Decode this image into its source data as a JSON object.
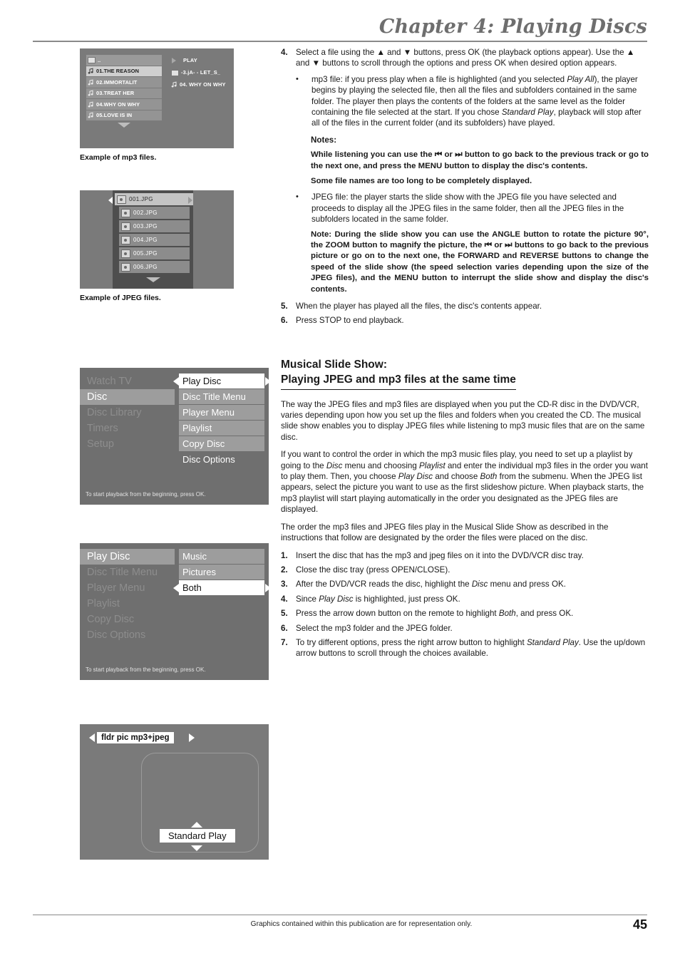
{
  "header": {
    "chapter_title": "Chapter 4: Playing Discs"
  },
  "footer": {
    "note": "Graphics contained within this publication are for representation only.",
    "page_number": "45"
  },
  "osd_mp3": {
    "caption": "Example of mp3 files.",
    "left_rows": [
      {
        "icon": "folder-icon",
        "label": "..",
        "state": "parent"
      },
      {
        "icon": "music-note-icon",
        "label": "01.THE REASON",
        "state": "selected"
      },
      {
        "icon": "music-note-icon",
        "label": "02.IMMORTALIT",
        "state": "normal"
      },
      {
        "icon": "music-note-icon",
        "label": "03.TREAT HER",
        "state": "normal"
      },
      {
        "icon": "music-note-icon",
        "label": "04.WHY ON WHY",
        "state": "normal"
      },
      {
        "icon": "music-note-icon",
        "label": "05.LOVE IS IN",
        "state": "normal"
      }
    ],
    "right_rows": [
      {
        "icon": "play-triangle-icon",
        "label": "PLAY"
      },
      {
        "icon": "folder-icon",
        "label": "-3.jA- - LET_S_"
      },
      {
        "icon": "music-note-icon",
        "label": "04. WHY ON WHY"
      }
    ]
  },
  "osd_jpeg": {
    "caption": "Example of JPEG files.",
    "rows": [
      {
        "icon": "photo-icon",
        "label": "001.JPG",
        "state": "selected"
      },
      {
        "icon": "photo-icon",
        "label": "002.JPG",
        "state": "normal"
      },
      {
        "icon": "photo-icon",
        "label": "003.JPG",
        "state": "normal"
      },
      {
        "icon": "photo-icon",
        "label": "004.JPG",
        "state": "normal"
      },
      {
        "icon": "photo-icon",
        "label": "005.JPG",
        "state": "normal"
      },
      {
        "icon": "photo-icon",
        "label": "006.JPG",
        "state": "normal"
      }
    ]
  },
  "osd_disc_menu": {
    "left_items": [
      {
        "label": "Watch TV",
        "state": "dim"
      },
      {
        "label": "Disc",
        "state": "active"
      },
      {
        "label": "Disc Library",
        "state": "dim"
      },
      {
        "label": "Timers",
        "state": "dim"
      },
      {
        "label": "Setup",
        "state": "dim"
      }
    ],
    "right_items": [
      {
        "label": "Play Disc",
        "state": "selected"
      },
      {
        "label": "Disc Title Menu",
        "state": "normal"
      },
      {
        "label": "Player Menu",
        "state": "normal"
      },
      {
        "label": "Playlist",
        "state": "normal"
      },
      {
        "label": "Copy Disc",
        "state": "normal"
      },
      {
        "label": "Disc Options",
        "state": "plain"
      }
    ],
    "hint": "To start playback from the beginning, press OK."
  },
  "osd_play_disc": {
    "left_items": [
      {
        "label": "Play Disc",
        "state": "active"
      },
      {
        "label": "Disc Title Menu",
        "state": "dim"
      },
      {
        "label": "Player Menu",
        "state": "dim"
      },
      {
        "label": "Playlist",
        "state": "dim"
      },
      {
        "label": "Copy Disc",
        "state": "dim"
      },
      {
        "label": "Disc Options",
        "state": "dim"
      }
    ],
    "right_items": [
      {
        "label": "Music",
        "state": "normal"
      },
      {
        "label": "Pictures",
        "state": "normal"
      },
      {
        "label": "Both",
        "state": "selected"
      }
    ],
    "hint": "To start playback from the beginning, press OK."
  },
  "osd_slideshow": {
    "folder_label": "fldr pic mp3+jpeg",
    "play_mode_label": "Standard Play"
  },
  "steps": {
    "step4_num": "4.",
    "step4_text_a": "Select a file using the ",
    "step4_up": "▲",
    "step4_and": " and ",
    "step4_down": "▼",
    "step4_text_b": " buttons, press OK (the playback options appear). Use the ",
    "step4_text_c": " buttons to scroll through the options and press OK when desired option appears.",
    "bullet_mp3_a": "mp3 file: if you press play when a file is highlighted (and you selected ",
    "bullet_mp3_i1": "Play All",
    "bullet_mp3_b": "), the player begins by playing the selected file, then all the files and subfolders contained in the same folder. The player then plays the contents of the folders at the same level as the folder containing the file selected at the start. If you chose ",
    "bullet_mp3_i2": "Standard Play",
    "bullet_mp3_c": ", playback will stop after all of the files in the current folder (and its subfolders) have played.",
    "notes_label": "Notes:",
    "note1": "While listening you can use the ⏮ or ⏭ button to go back to the previous track or go to the next one, and press the MENU button to display the disc's contents.",
    "note2": "Some file names are too long to be completely displayed.",
    "bullet_jpeg": "JPEG file: the player starts the slide show with the JPEG file you have selected and proceeds to display all the JPEG files in the same folder, then all the JPEG files in the subfolders located in the same folder.",
    "note3": "Note: During the slide show you can use the ANGLE button to rotate the picture 90°, the ZOOM button to magnify the picture, the ⏮ or ⏭ buttons to go back to the previous picture or go on to the next one, the FORWARD and REVERSE buttons to change the speed of the slide show (the speed selection varies depending upon the size of the JPEG files), and the MENU button to interrupt the slide show and display the disc's contents.",
    "step5_num": "5.",
    "step5_text": "When the player has played all the files, the disc's contents appear.",
    "step6_num": "6.",
    "step6_text": "Press STOP to end playback."
  },
  "section": {
    "heading_line1": "Musical Slide Show:",
    "heading_line2": "Playing JPEG and mp3 files at the same time",
    "para1": "The way the JPEG files and mp3 files are displayed when you put the CD-R disc in the DVD/VCR, varies depending upon how you set up the files and folders when you created the CD. The musical slide show enables you to display JPEG files while listening to mp3 music files that are on the same disc.",
    "para2_a": "If you want to control the order in which the mp3 music files play, you need to set up a playlist by going to the ",
    "para2_i1": "Disc",
    "para2_b": " menu and choosing ",
    "para2_i2": "Playlist",
    "para2_c": " and enter the individual mp3 files in the order you want to play them. Then, you choose ",
    "para2_i3": "Play Disc",
    "para2_d": " and choose ",
    "para2_i4": "Both",
    "para2_e": " from the submenu. When the JPEG list appears, select the picture you want to use as the first slideshow picture. When playback starts, the mp3 playlist will start playing automatically in the order you designated as the JPEG files are displayed.",
    "para3": "The order the mp3 files and JPEG files play in the Musical Slide Show as described in the instructions that follow are designated by the order the files were placed on the disc.",
    "list": [
      {
        "num": "1.",
        "text": "Insert the disc that has the mp3 and jpeg files on it into the DVD/VCR disc tray."
      },
      {
        "num": "2.",
        "text": "Close the disc tray (press OPEN/CLOSE)."
      },
      {
        "num": "3.",
        "pre": "After the DVD/VCR reads the disc, highlight the ",
        "ital": "Disc",
        "post": " menu and press OK."
      },
      {
        "num": "4.",
        "pre": "Since ",
        "ital": "Play Disc",
        "post": " is highlighted, just press OK."
      },
      {
        "num": "5.",
        "pre": "Press the arrow down button on the remote to highlight ",
        "ital": "Both",
        "post": ", and press OK."
      },
      {
        "num": "6.",
        "text": "Select the mp3 folder and the JPEG folder."
      },
      {
        "num": "7.",
        "pre": "To try different options, press the right arrow button to highlight ",
        "ital": "Standard Play",
        "post": ". Use the up/down arrow buttons to scroll through the choices available."
      }
    ]
  }
}
